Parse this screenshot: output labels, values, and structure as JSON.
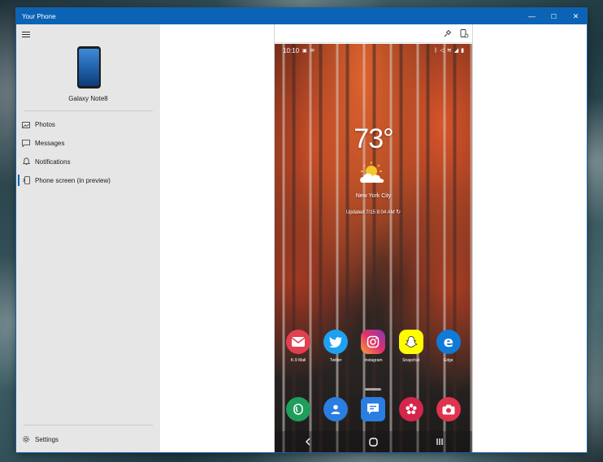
{
  "window": {
    "title": "Your Phone",
    "accent": "#0b63b6",
    "controls": {
      "minimize": "—",
      "maximize": "☐",
      "close": "✕"
    }
  },
  "sidebar": {
    "device_name": "Galaxy Note8",
    "items": [
      {
        "label": "Photos",
        "icon": "photos-icon"
      },
      {
        "label": "Messages",
        "icon": "messages-icon"
      },
      {
        "label": "Notifications",
        "icon": "bell-icon"
      },
      {
        "label": "Phone screen (in preview)",
        "icon": "phone-screen-icon",
        "active": true
      }
    ],
    "settings_label": "Settings"
  },
  "phone": {
    "status": {
      "time": "10:10"
    },
    "weather": {
      "temperature": "73°",
      "city": "New York City",
      "updated": "Updated 7/15 8:04 AM"
    },
    "apps": [
      {
        "label": "K-9 Mail",
        "color": "#e0404f",
        "glyph": "✉"
      },
      {
        "label": "Twitter",
        "color": "#1da1f2",
        "glyph": "🐦"
      },
      {
        "label": "Instagram",
        "color": "#c13584",
        "glyph": "◎"
      },
      {
        "label": "Snapchat",
        "color": "#fffc00",
        "glyph": "👻"
      },
      {
        "label": "Edge",
        "color": "#0f7ad8",
        "glyph": "e"
      }
    ],
    "dock": [
      {
        "name": "phone",
        "color": "#1f9e5a"
      },
      {
        "name": "contacts",
        "color": "#2a7de1"
      },
      {
        "name": "messages",
        "color": "#2a7de1"
      },
      {
        "name": "bixby",
        "color": "#d4264a"
      },
      {
        "name": "camera",
        "color": "#e0334d"
      }
    ]
  }
}
